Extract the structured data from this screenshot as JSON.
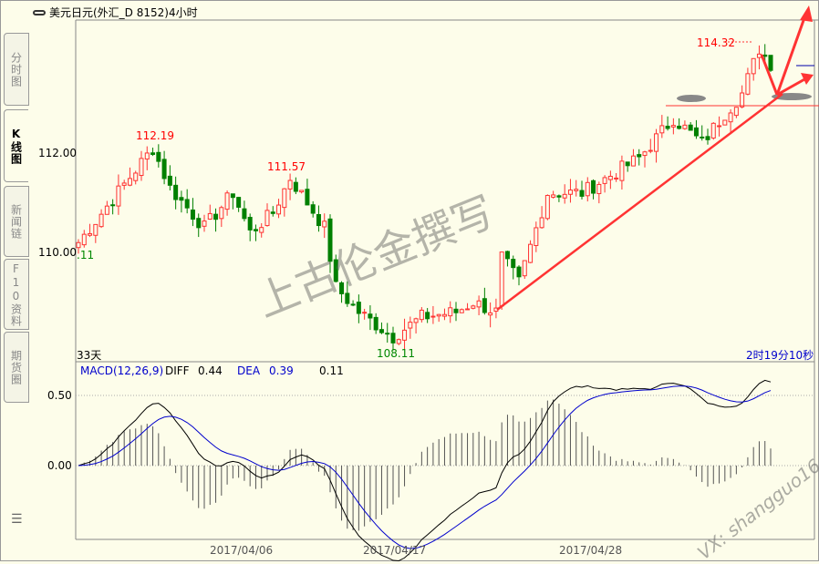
{
  "window": {
    "title": "美元日元(外汇_D 8152)4小时",
    "link_icon": "link-icon"
  },
  "tabs": [
    {
      "label": "分时图"
    },
    {
      "label": "K线图",
      "active": true
    },
    {
      "label": "新闻链"
    },
    {
      "label": "F10资料"
    },
    {
      "label": "期货圈"
    }
  ],
  "main": {
    "period_label": "33天",
    "countdown": "2时19分10秒",
    "y_ticks": [
      "112.00",
      "110.00"
    ],
    "annotations": {
      "high1": "112.19",
      "high2": "111.57",
      "low": "108.11",
      "left_value": ".11",
      "peak": "114.32"
    }
  },
  "macd": {
    "title": "MACD(12,26,9)",
    "diff_label": "DIFF",
    "diff_value": "0.44",
    "dea_label": "DEA",
    "dea_value": "0.39",
    "macd_value": "0.11",
    "y_ticks": [
      "0.50",
      "0.00"
    ]
  },
  "x_axis": {
    "dates": [
      "2017/04/06",
      "2017/04/17",
      "2017/04/28"
    ]
  },
  "watermark": {
    "text": "上古伦金撰写",
    "vx": "VX: shangguo16"
  },
  "colors": {
    "up": "#ff3232",
    "down": "#008000",
    "diff": "#000000",
    "dea": "#0000cc",
    "bg": "#fdfdea"
  },
  "chart_data": {
    "type": "candlestick",
    "ylim": [
      107.7,
      114.6
    ],
    "close_path": [
      [
        0,
        110.2
      ],
      [
        13,
        112.1
      ],
      [
        16,
        111.3
      ],
      [
        22,
        110.5
      ],
      [
        27,
        111.2
      ],
      [
        30,
        110.4
      ],
      [
        34,
        110.8
      ],
      [
        37,
        111.5
      ],
      [
        43,
        110.5
      ],
      [
        45,
        109.3
      ],
      [
        49,
        108.8
      ],
      [
        55,
        108.3
      ],
      [
        60,
        108.7
      ],
      [
        66,
        108.8
      ],
      [
        69,
        109.0
      ],
      [
        73,
        108.8
      ],
      [
        74,
        109.9
      ],
      [
        77,
        109.4
      ],
      [
        82,
        111.2
      ],
      [
        88,
        111.2
      ],
      [
        98,
        111.9
      ],
      [
        104,
        112.7
      ],
      [
        109,
        112.2
      ],
      [
        113,
        112.8
      ],
      [
        116,
        113.2
      ],
      [
        119,
        114.1
      ],
      [
        121,
        113.8
      ]
    ]
  }
}
